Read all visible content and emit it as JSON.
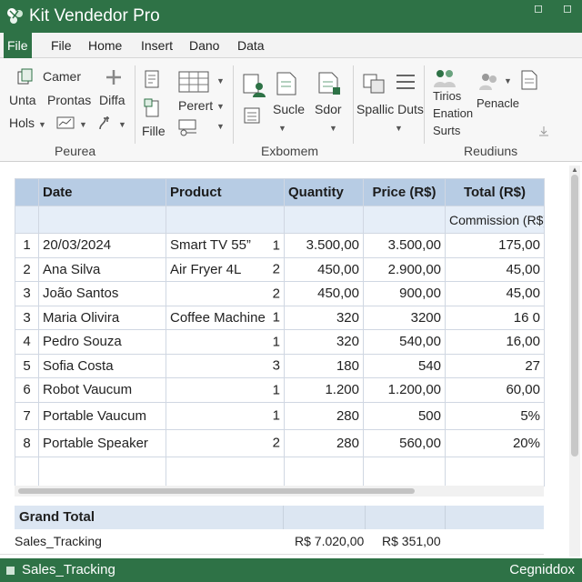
{
  "window": {
    "title": "Kit Vendedor Pro",
    "minimize_glyph": "◻",
    "close_glyph": "◻"
  },
  "menu": [
    "File",
    "File",
    "Home",
    "Insert",
    "Dano",
    "Data"
  ],
  "ribbon": {
    "camera": "Camer",
    "unta": "Unta",
    "prontas": "Prontas",
    "diffa": "Diffa",
    "hols": "Hols",
    "fille": "Fille",
    "perert": "Perert",
    "sucle": "Sucle",
    "sdor": "Sdor",
    "spallic_duts": "Spallic Duts",
    "tirios": "Tirios",
    "enation": "Enation",
    "surts": "Surts",
    "penacle": "Penacle",
    "groups": [
      "Peurea",
      "Exbomem",
      "Reudiuns"
    ],
    "accent": "#2e7246",
    "icons": [
      "copy-icon",
      "plus-icon",
      "chart-icon",
      "brush-icon",
      "document-icon",
      "table-icon",
      "paste-icon",
      "person-icon",
      "page-icon",
      "page-add-icon",
      "image-icon",
      "list-icon",
      "people-icon",
      "team-icon",
      "doc-icon",
      "sign-icon"
    ]
  },
  "table": {
    "headers": [
      "",
      "Date",
      "Product",
      "Quantity",
      "Price (R$)",
      "Total (R$)"
    ],
    "subheader": "Commission (R$)",
    "rows": [
      {
        "n": "1",
        "name": "20/03/2024",
        "product": "Smart TV 55”",
        "qty": "1",
        "quantity": "3.500,00",
        "price": "3.500,00",
        "total": "175,00"
      },
      {
        "n": "2",
        "name": "Ana Silva",
        "product": "Air Fryer 4L",
        "qty": "2",
        "quantity": "450,00",
        "price": "2.900,00",
        "total": "45,00"
      },
      {
        "n": "3",
        "name": "João Santos",
        "product": "",
        "qty": "2",
        "quantity": "450,00",
        "price": "900,00",
        "total": "45,00"
      },
      {
        "n": "3",
        "name": "Maria Olivira",
        "product": "Coffee Machine",
        "qty": "1",
        "quantity": "320",
        "price": "3200",
        "total": "16  0"
      },
      {
        "n": "4",
        "name": "Pedro Souza",
        "product": "",
        "qty": "1",
        "quantity": "320",
        "price": "540,00",
        "total": "16,00"
      },
      {
        "n": "5",
        "name": "Sofia Costa",
        "product": "",
        "qty": "3",
        "quantity": "180",
        "price": "540",
        "total": "27"
      },
      {
        "n": "6",
        "name": "Robot Vaucum",
        "product": "",
        "qty": "1",
        "quantity": "1.200",
        "price": "1.200,00",
        "total": "60,00"
      },
      {
        "n": "7",
        "name": "Portable Vaucum",
        "product": "",
        "qty": "1",
        "quantity": "280",
        "price": "500",
        "total": "5%"
      },
      {
        "n": "8",
        "name": "Portable Speaker",
        "product": "",
        "qty": "2",
        "quantity": "280",
        "price": "560,00",
        "total": "20%"
      }
    ]
  },
  "grand_total": {
    "label": "Grand Total",
    "sheet": "Sales_Tracking",
    "total_value": "R$ 7.020,00",
    "commission_value": "R$ 351,00"
  },
  "status": {
    "sheet_tab": "Sales_Tracking",
    "right_text": "Cegniddox"
  }
}
